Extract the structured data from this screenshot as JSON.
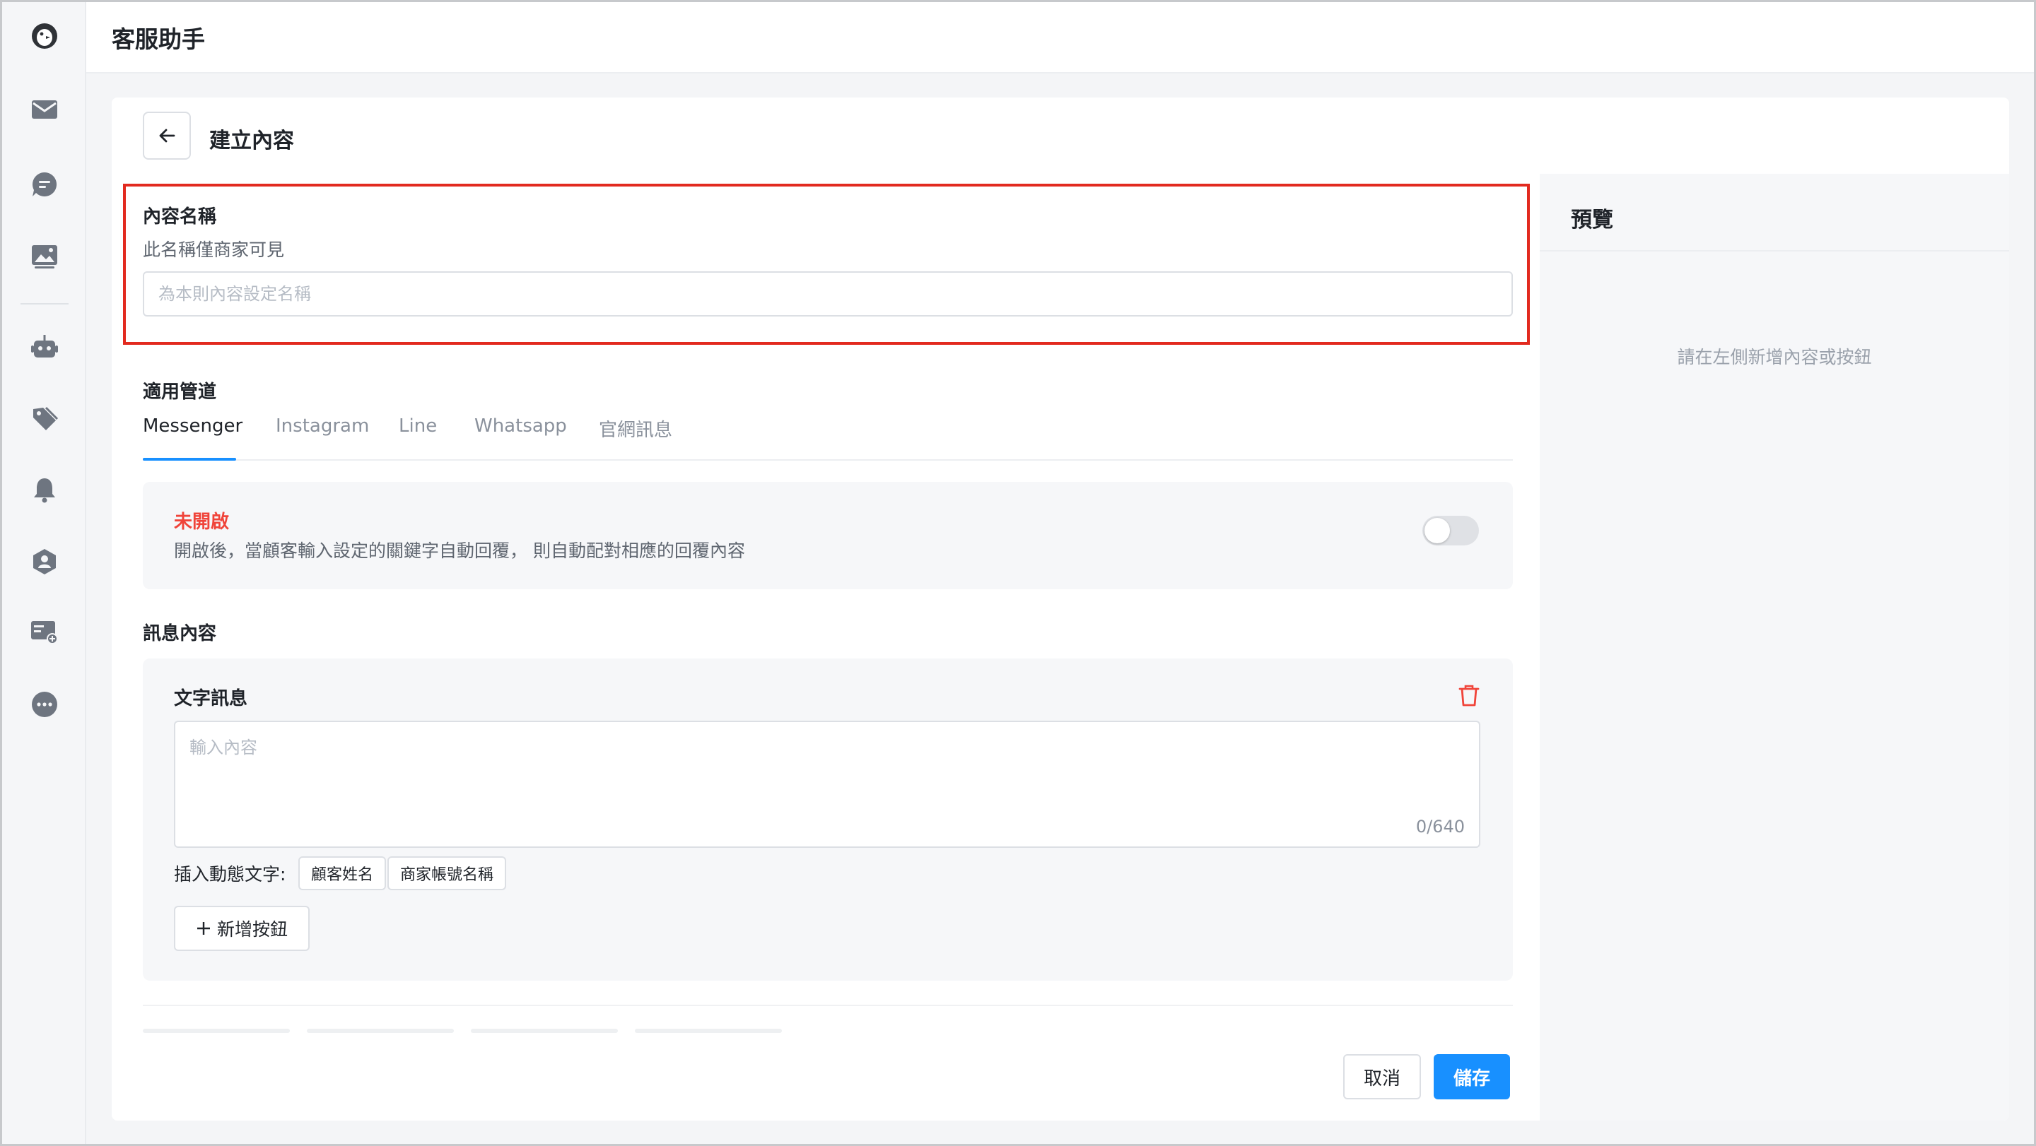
{
  "app": {
    "title": "客服助手"
  },
  "sidebar": {
    "logo": "penguin-logo-icon",
    "items": [
      {
        "icon": "mail-icon"
      },
      {
        "icon": "chat-icon"
      },
      {
        "icon": "image-icon"
      },
      {
        "icon": "bot-icon"
      },
      {
        "icon": "tag-icon"
      },
      {
        "icon": "bell-icon"
      },
      {
        "icon": "user-shield-icon"
      },
      {
        "icon": "card-add-icon"
      },
      {
        "icon": "more-icon"
      }
    ]
  },
  "page": {
    "title": "建立內容",
    "back_icon": "arrow-left-icon"
  },
  "name_section": {
    "label": "內容名稱",
    "hint": "此名稱僅商家可見",
    "placeholder": "為本則內容設定名稱",
    "value": ""
  },
  "channels": {
    "label": "適用管道",
    "tabs": [
      "Messenger",
      "Instagram",
      "Line",
      "Whatsapp",
      "官網訊息"
    ],
    "active": "Messenger"
  },
  "keyword": {
    "status": "未開啟",
    "description": "開啟後，當顧客輸入設定的關鍵字自動回覆， 則自動配對相應的回覆內容",
    "enabled": false
  },
  "message": {
    "section_label": "訊息內容",
    "block_title": "文字訊息",
    "placeholder": "輸入內容",
    "counter": "0/640",
    "insert_label": "插入動態文字:",
    "chips": [
      "顧客姓名",
      "商家帳號名稱"
    ],
    "add_button": "新增按鈕"
  },
  "preview": {
    "title": "預覽",
    "empty": "請在左側新增內容或按鈕"
  },
  "footer": {
    "cancel": "取消",
    "save": "儲存"
  },
  "colors": {
    "accent": "#1890ff",
    "danger": "#f0443a",
    "highlight": "#e22a1f"
  }
}
